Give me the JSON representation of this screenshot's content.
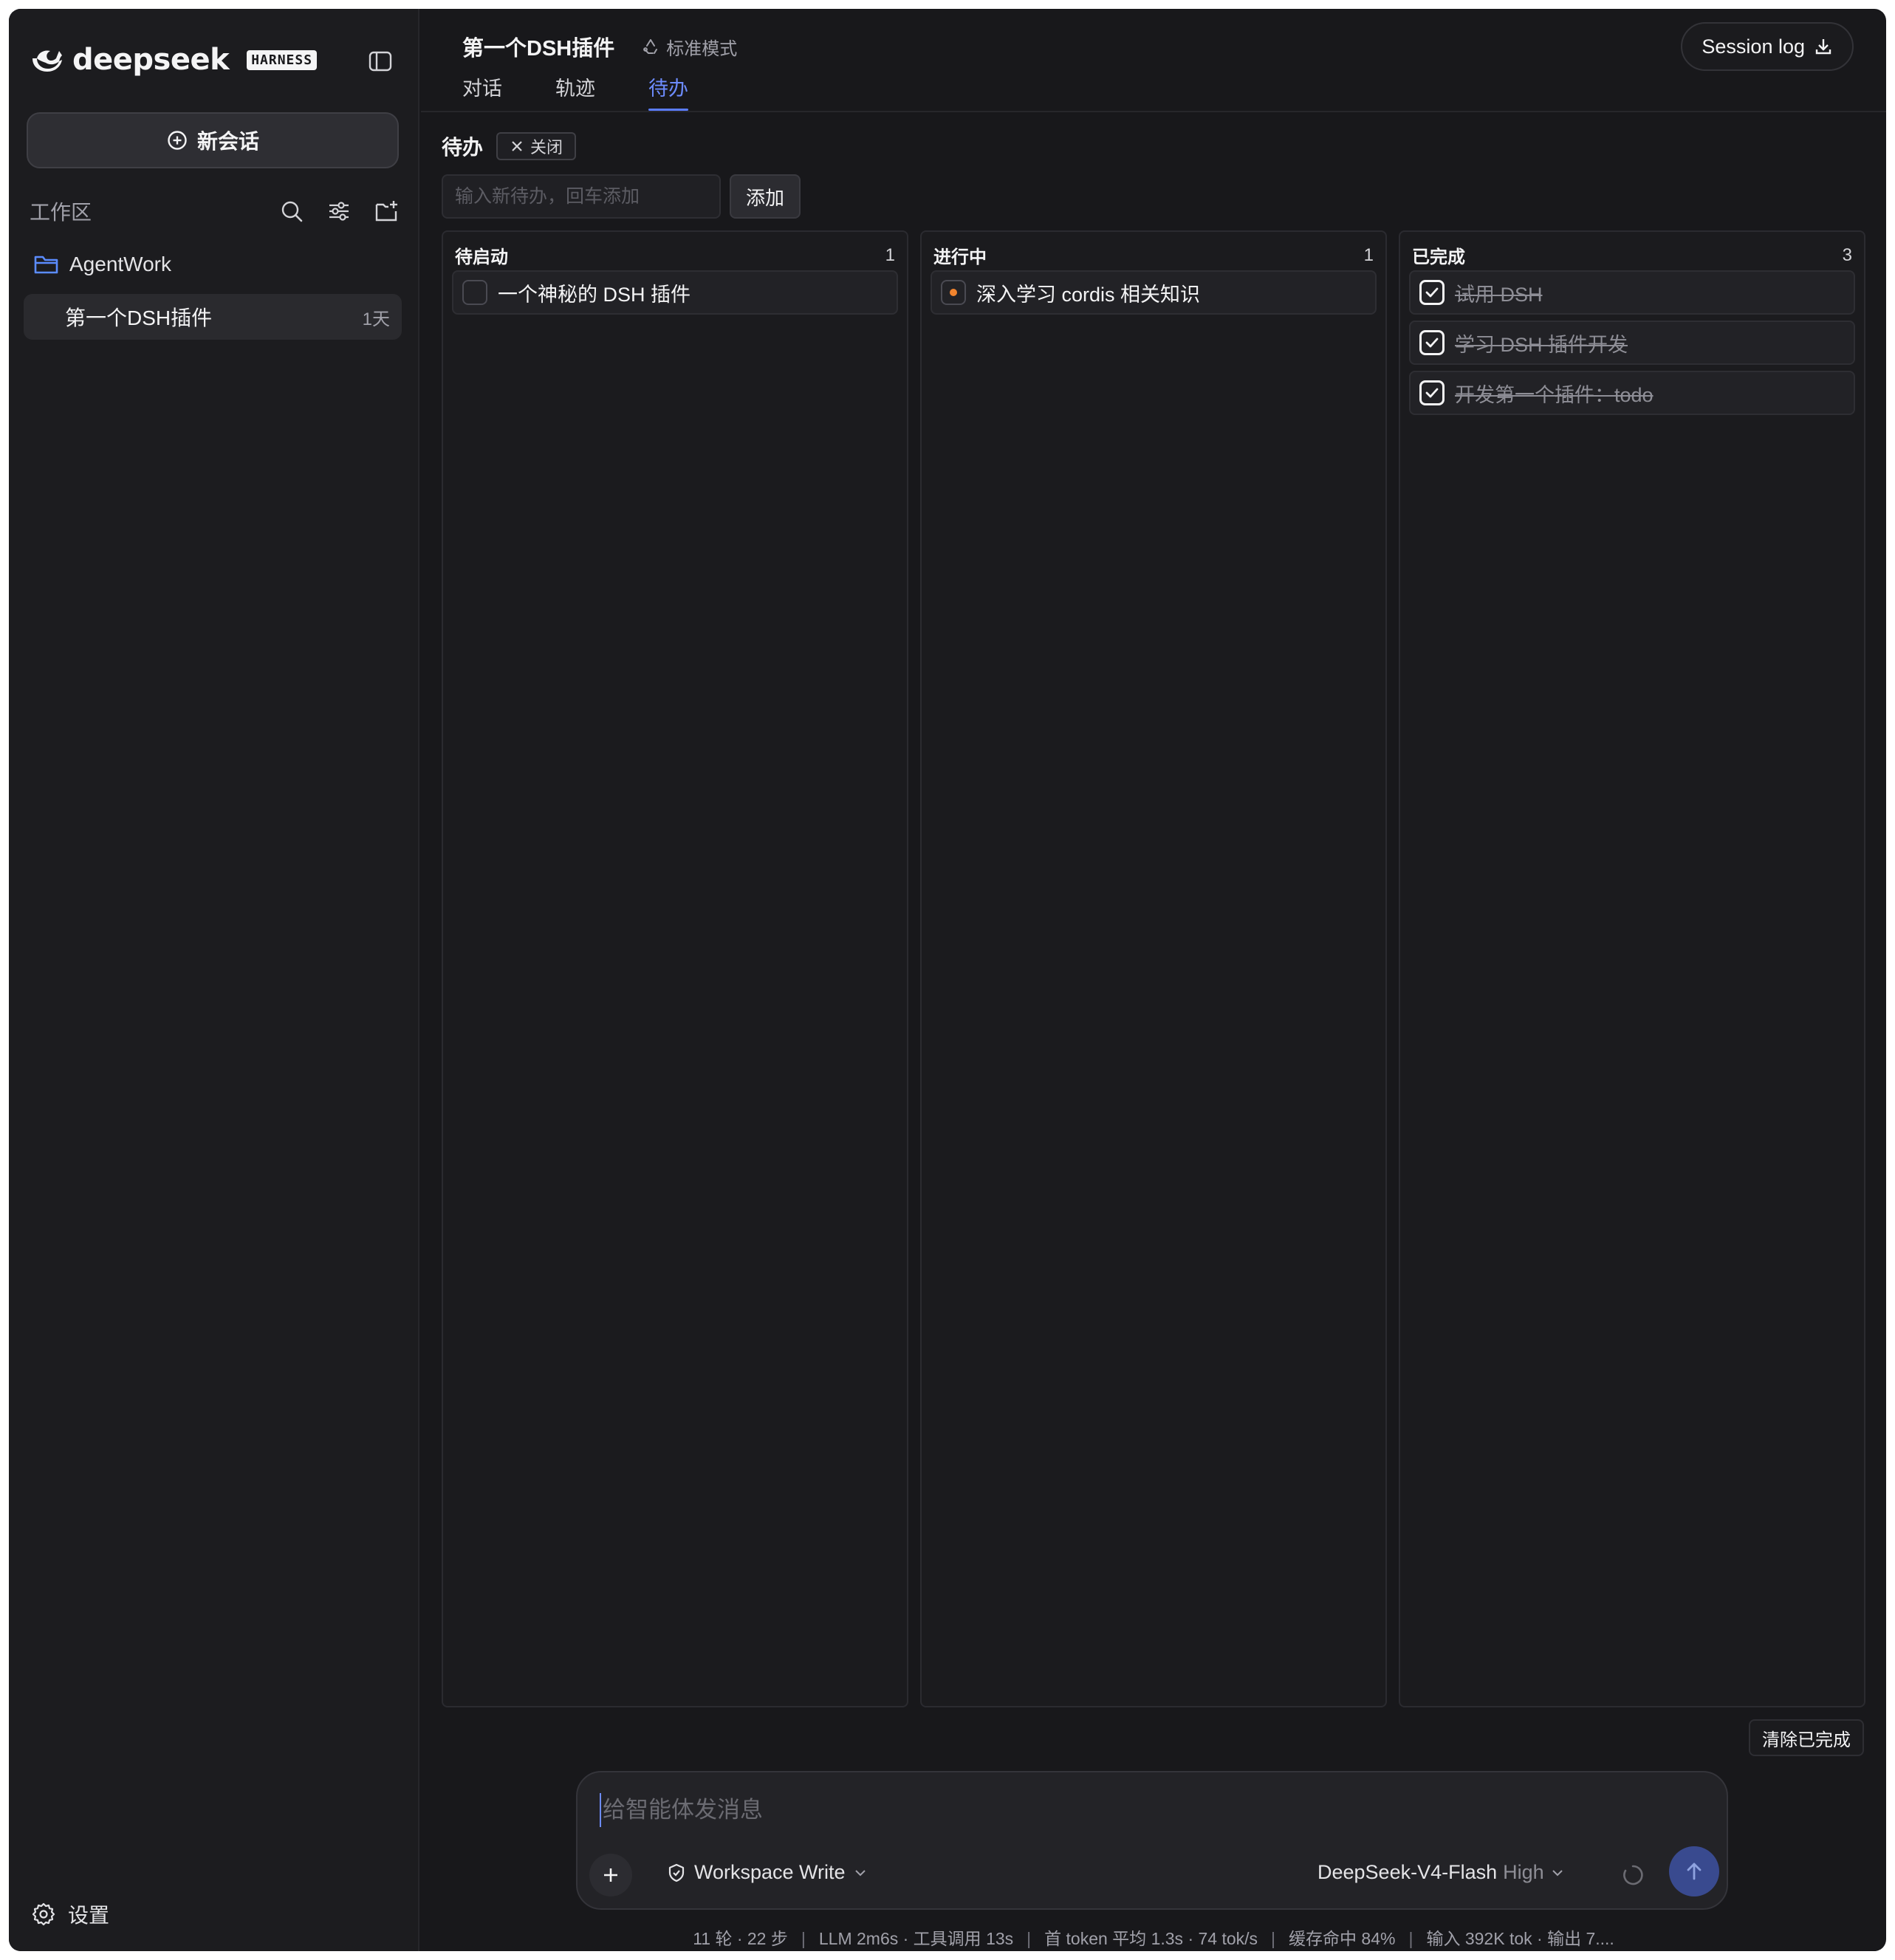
{
  "app": {
    "logo_text": "deepseek",
    "logo_badge": "HARNESS",
    "accent": "#5b7cff"
  },
  "sidebar": {
    "new_chat_label": "新会话",
    "workspace_label": "工作区",
    "icons": [
      "search-icon",
      "filter-icon",
      "new-folder-icon"
    ],
    "folder": {
      "name": "AgentWork",
      "icon": "folder-icon"
    },
    "session": {
      "title": "第一个DSH插件",
      "age": "1天"
    },
    "settings_label": "设置"
  },
  "header": {
    "title": "第一个DSH插件",
    "mode": "标准模式",
    "session_log": "Session log",
    "tabs": [
      {
        "label": "对话",
        "active": false
      },
      {
        "label": "轨迹",
        "active": false
      },
      {
        "label": "待办",
        "active": true
      }
    ]
  },
  "todo": {
    "title": "待办",
    "close_label": "关闭",
    "input_placeholder": "输入新待办，回车添加",
    "add_label": "添加",
    "clear_done_label": "清除已完成",
    "columns": [
      {
        "title": "待启动",
        "count": "1",
        "items": [
          {
            "text": "一个神秘的 DSH 插件",
            "state": "pending"
          }
        ]
      },
      {
        "title": "进行中",
        "count": "1",
        "items": [
          {
            "text": "深入学习 cordis 相关知识",
            "state": "in-progress"
          }
        ]
      },
      {
        "title": "已完成",
        "count": "3",
        "items": [
          {
            "text": "试用 DSH",
            "state": "done"
          },
          {
            "text": "学习 DSH 插件开发",
            "state": "done"
          },
          {
            "text": "开发第一个插件：todo",
            "state": "done"
          }
        ]
      }
    ]
  },
  "composer": {
    "placeholder": "给智能体发消息",
    "permission": "Workspace Write",
    "model": "DeepSeek-V4-Flash",
    "level": "High"
  },
  "stats": {
    "rounds": "11 轮 · 22 步",
    "llm": "LLM 2m6s · 工具调用 13s",
    "first_token": "首 token 平均 1.3s · 74 tok/s",
    "cache": "缓存命中 84%",
    "io": "输入 392K tok · 输出 7...."
  }
}
